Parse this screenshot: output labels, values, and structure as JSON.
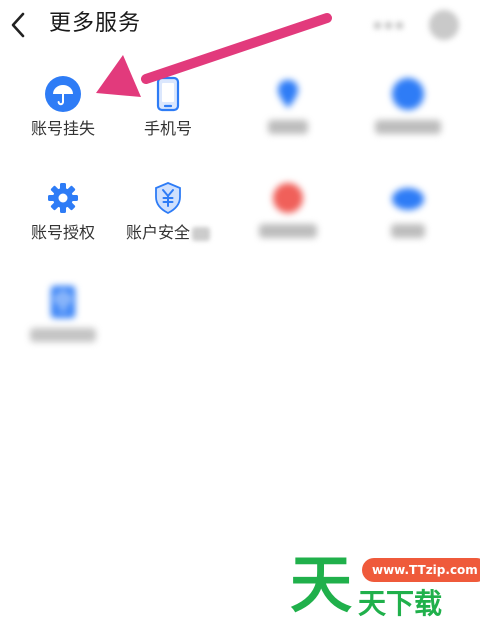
{
  "header": {
    "title": "更多服务"
  },
  "services": {
    "account_lost": "账号挂失",
    "phone": "手机号",
    "account_auth": "账号授权",
    "account_security": "账户安全"
  },
  "watermark": {
    "big_char": "天",
    "url": "www.TTzip.com",
    "text": "天下载"
  },
  "colors": {
    "icon_blue": "#2e7cf6",
    "arrow_pink": "#e23a7c",
    "watermark_green": "#20b04b",
    "watermark_orange": "#ef5a3b"
  }
}
